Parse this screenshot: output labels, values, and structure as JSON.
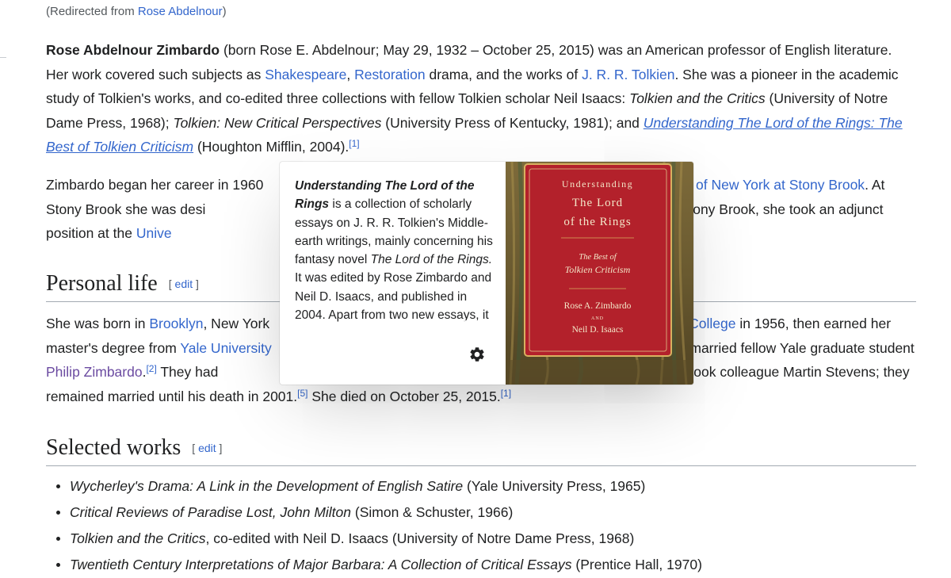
{
  "redirect": {
    "prefix": "(Redirected from ",
    "link": "Rose Abdelnour",
    "suffix": ")"
  },
  "intro": {
    "subject": "Rose Abdelnour Zimbardo",
    "t1": " (born Rose E. Abdelnour; May 29, 1932 – October 25, 2015) was an American professor of English literature. Her work covered such subjects as ",
    "link_shakespeare": "Shakespeare",
    "t2": ", ",
    "link_restoration": "Restoration",
    "t3": " drama, and the works of ",
    "link_tolkien": "J. R. R. Tolkien",
    "t4": ". She was a pioneer in the academic study of Tolkien's works, and co-edited three collections with fellow Tolkien scholar Neil Isaacs: ",
    "book1": "Tolkien and the Critics",
    "t5": " (University of Notre Dame Press, 1968); ",
    "book2": "Tolkien: New Critical Perspectives",
    "t6": " (University Press of Kentucky, 1981); and ",
    "link_book3": "Understanding The Lord of the Rings: The Best of Tolkien Criticism",
    "t7": " (Houghton Mifflin, 2004).",
    "ref": "[1]"
  },
  "career": {
    "t1": "Zimbardo began her career in 1960",
    "link_suny": "University of New York at Stony Brook",
    "t2": ". At Stony Brook she was desi",
    "t3": "retired from Stony Brook, she took an adjunct position at the ",
    "link_univ": "Unive"
  },
  "personal": {
    "heading": "Personal life",
    "edit": "edit",
    "t1": "She was born in ",
    "link_brooklyn": "Brooklyn",
    "t2": ", New York",
    "link_college": "College",
    "t3": " in 1956, then earned her master's degree from ",
    "link_yale": "Yale University",
    "t4": "e married fellow Yale graduate student ",
    "link_philip": "Philip Zimbardo",
    "t5": ".",
    "ref2": "[2]",
    "t6": " They had",
    "t7": " Stony Brook colleague Martin Stevens; they remained married until his death in 2001.",
    "ref5": "[5]",
    "t8": " She died on October 25, 2015.",
    "ref1": "[1]"
  },
  "selected": {
    "heading": "Selected works",
    "edit": "edit",
    "items": [
      {
        "title": "Wycherley's Drama: A Link in the Development of English Satire",
        "rest": " (Yale University Press, 1965)"
      },
      {
        "title": "Critical Reviews of Paradise Lost, John Milton",
        "rest": " (Simon & Schuster, 1966)"
      },
      {
        "title": "Tolkien and the Critics",
        "rest": ", co-edited with Neil D. Isaacs (University of Notre Dame Press, 1968)"
      },
      {
        "title": "Twentieth Century Interpretations of Major Barbara: A Collection of Critical Essays",
        "rest": " (Prentice Hall, 1970)"
      }
    ]
  },
  "popup": {
    "title": "Understanding The Lord of the Rings",
    "t1": " is a collection of scholarly essays on J. R. R. Tolkien's Middle-earth writings, mainly concerning his fantasy novel ",
    "novel": "The Lord of the Rings.",
    "t2": " It was edited by Rose Zimbardo and Neil D. Isaacs, and published in 2004. Apart from two new essays, it",
    "settings_icon": "gear-icon",
    "cover": {
      "title_line1": "Understanding",
      "title_line2": "The Lord",
      "title_line3": "of the Rings",
      "subtitle1": "The Best of",
      "subtitle2": "Tolkien Criticism",
      "author1": "Rose A. Zimbardo",
      "and": "AND",
      "author2": "Neil D. Isaacs"
    }
  },
  "colors": {
    "link": "#3366cc",
    "visited": "#6b4ba1",
    "text": "#202122",
    "cover_red": "#b3212b"
  }
}
